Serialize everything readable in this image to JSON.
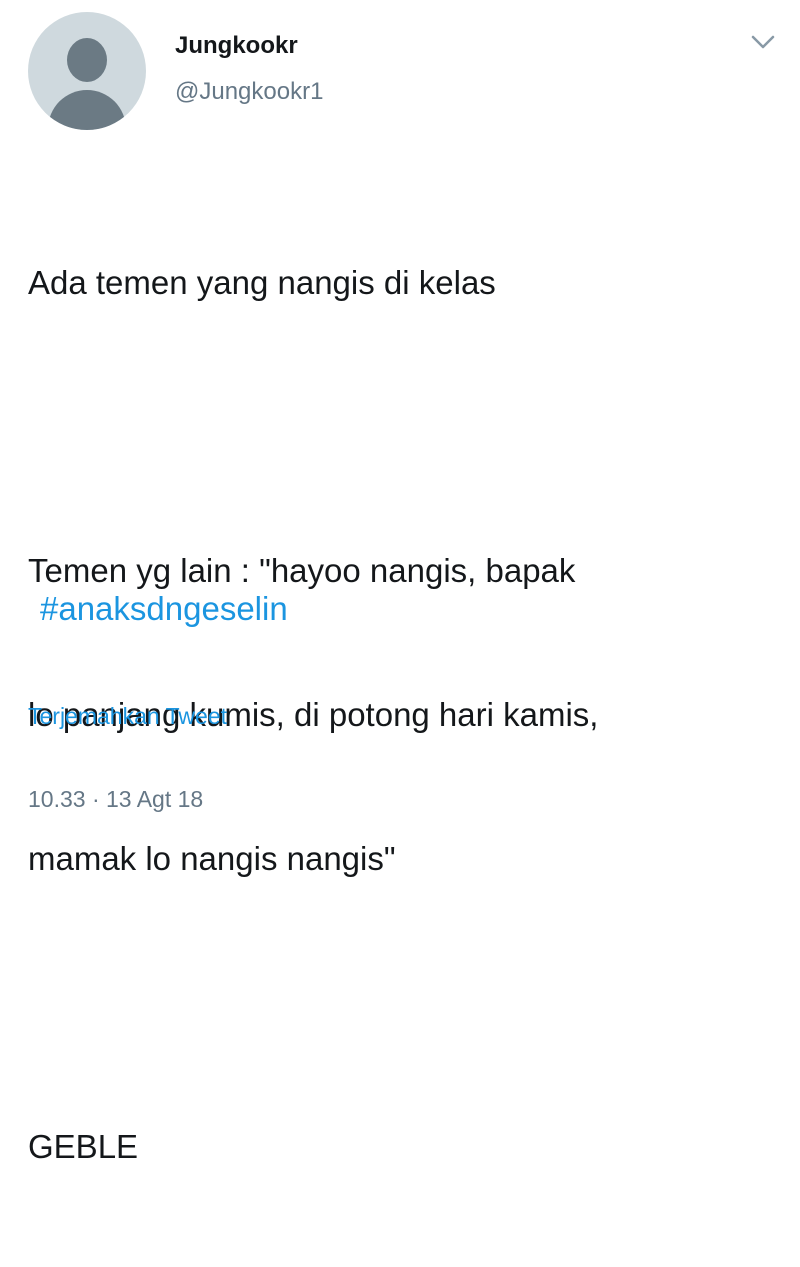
{
  "tweet": {
    "author": {
      "display_name": "Jungkookr",
      "handle": "@Jungkookr1",
      "avatar_icon": "default-profile-icon"
    },
    "menu_icon": "chevron-down-icon",
    "body": {
      "line1": "Ada temen yang nangis di kelas",
      "line2": "Temen yg lain : \"hayoo nangis, bapak",
      "line3": "lo panjang kumis, di potong hari kamis,",
      "line4": "mamak lo nangis nangis\"",
      "line5": "GEBLE"
    },
    "hashtag": "#anaksdngeselin",
    "translate_label": "Terjemahkan Tweet",
    "timestamp": "10.33 · 13 Agt 18"
  },
  "colors": {
    "link": "#1b95e0",
    "secondary_text": "#657786",
    "primary_text": "#14171a"
  }
}
